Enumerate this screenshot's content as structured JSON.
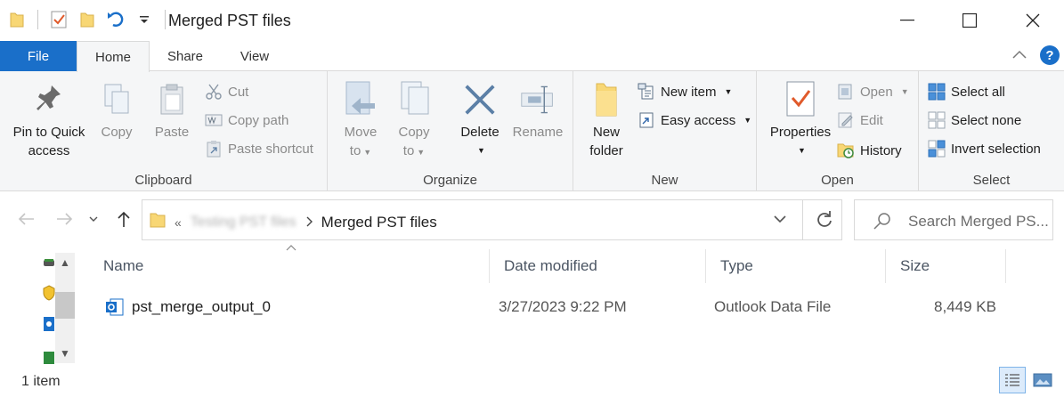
{
  "window": {
    "title": "Merged PST files"
  },
  "tabs": {
    "file": "File",
    "home": "Home",
    "share": "Share",
    "view": "View"
  },
  "ribbon": {
    "clipboard": {
      "label": "Clipboard",
      "pin_line1": "Pin to Quick",
      "pin_line2": "access",
      "copy": "Copy",
      "paste": "Paste",
      "cut": "Cut",
      "copy_path": "Copy path",
      "paste_shortcut": "Paste shortcut"
    },
    "organize": {
      "label": "Organize",
      "move_line1": "Move",
      "move_line2": "to",
      "copy_line1": "Copy",
      "copy_line2": "to",
      "delete": "Delete",
      "rename": "Rename"
    },
    "new": {
      "label": "New",
      "folder_line1": "New",
      "folder_line2": "folder",
      "new_item": "New item",
      "easy_access": "Easy access"
    },
    "open": {
      "label": "Open",
      "properties": "Properties",
      "open": "Open",
      "edit": "Edit",
      "history": "History"
    },
    "select": {
      "label": "Select",
      "select_all": "Select all",
      "select_none": "Select none",
      "invert_selection": "Invert selection"
    }
  },
  "address": {
    "overflow": "«",
    "parent_folder": "Testing PST files",
    "current_folder": "Merged PST files"
  },
  "search": {
    "placeholder": "Search Merged PS..."
  },
  "file_list": {
    "columns": [
      "Name",
      "Date modified",
      "Type",
      "Size"
    ],
    "rows": [
      {
        "name": "pst_merge_output_0",
        "date_modified": "3/27/2023 9:22 PM",
        "type": "Outlook Data File",
        "size": "8,449 KB"
      }
    ]
  },
  "status": {
    "item_count": "1 item"
  },
  "colors": {
    "accent": "#1a6fc9",
    "ribbon_bg": "#f5f6f7",
    "folder_yellow": "#f8d775",
    "delete_blue": "#5b7fa6"
  }
}
